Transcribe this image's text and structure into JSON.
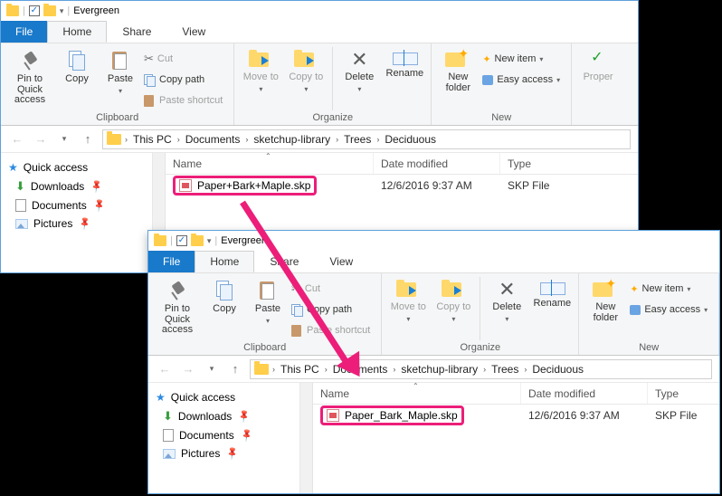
{
  "title_bar": {
    "title": "Evergreen"
  },
  "tabs": {
    "file": "File",
    "home": "Home",
    "share": "Share",
    "view": "View"
  },
  "ribbon": {
    "clipboard": {
      "label": "Clipboard",
      "pin": "Pin to Quick access",
      "copy": "Copy",
      "paste": "Paste",
      "cut": "Cut",
      "copy_path": "Copy path",
      "paste_shortcut": "Paste shortcut"
    },
    "organize": {
      "label": "Organize",
      "move_to": "Move to",
      "copy_to": "Copy to",
      "delete": "Delete",
      "rename": "Rename"
    },
    "new": {
      "label": "New",
      "new_folder": "New folder",
      "new_item": "New item",
      "easy_access": "Easy access"
    },
    "open": {
      "properties": "Proper"
    }
  },
  "breadcrumbs": [
    "This PC",
    "Documents",
    "sketchup-library",
    "Trees",
    "Deciduous"
  ],
  "sidebar": {
    "quick_access": "Quick access",
    "downloads": "Downloads",
    "documents": "Documents",
    "pictures": "Pictures"
  },
  "columns": {
    "name": "Name",
    "date": "Date modified",
    "type": "Type"
  },
  "files": {
    "before": {
      "name": "Paper+Bark+Maple.skp",
      "date": "12/6/2016 9:37 AM",
      "type": "SKP File"
    },
    "after": {
      "name": "Paper_Bark_Maple.skp",
      "date": "12/6/2016 9:37 AM",
      "type": "SKP File"
    }
  }
}
